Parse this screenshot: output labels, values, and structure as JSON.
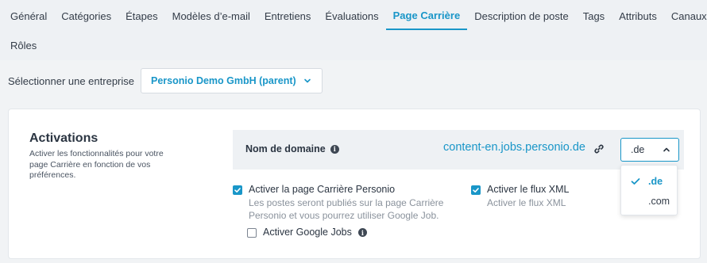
{
  "tabs_row1": [
    "Général",
    "Catégories",
    "Étapes",
    "Modèles d’e-mail",
    "Entretiens",
    "Évaluations",
    "Page Carrière",
    "Description de poste",
    "Tags",
    "Attributs",
    "Canaux"
  ],
  "tabs_row2": [
    "Rôles"
  ],
  "active_tab": "Page Carrière",
  "company": {
    "label": "Sélectionner une entreprise",
    "value": "Personio Demo GmbH (parent)"
  },
  "activations": {
    "title": "Activations",
    "description": "Activer les fonctionnalités pour votre page Carrière en fonction de vos préférences."
  },
  "domain": {
    "label": "Nom de domaine",
    "value": "content-en.jobs.personio.de",
    "tld_selected": ".de",
    "tld_options": [
      ".de",
      ".com"
    ]
  },
  "checkboxes": {
    "career_page": {
      "label": "Activer la page Carrière Personio",
      "description": "Les postes seront publiés sur la page Carrière Personio et vous pourrez utiliser Google Job.",
      "checked": true
    },
    "google_jobs": {
      "label": "Activer Google Jobs",
      "checked": false
    },
    "xml_feed": {
      "label": "Activer le flux XML",
      "description": "Activer le flux XML",
      "checked": true
    }
  },
  "colors": {
    "accent": "#1996c8",
    "background": "#f1f3f5",
    "text": "#333c48"
  },
  "icons": {
    "info": "info-icon",
    "link": "link-icon",
    "chevron": "chevron-down-icon",
    "check": "check-icon"
  }
}
